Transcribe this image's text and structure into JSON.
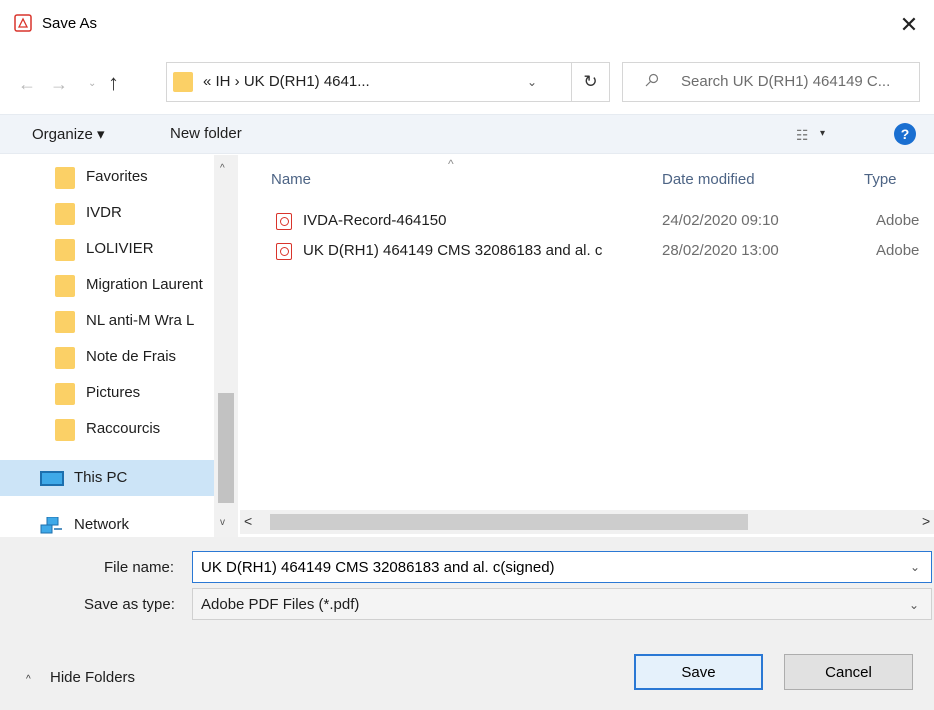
{
  "window": {
    "title": "Save As",
    "close_glyph": "✕",
    "title_icon": "pdf-icon"
  },
  "nav": {
    "back_glyph": "←",
    "forward_glyph": "→",
    "recent_glyph": "⌄",
    "up_glyph": "↑",
    "address_path": "«  IH  ›  UK D(RH1) 4641...",
    "address_chevron": "⌄",
    "refresh_glyph": "↻",
    "search_placeholder": "Search UK D(RH1) 464149 C..."
  },
  "toolbar": {
    "organize_label": "Organize ▾",
    "new_folder_label": "New folder",
    "view_glyph": "☷",
    "view_chevron": "▾",
    "help_glyph": "?"
  },
  "sidebar": {
    "folders": [
      {
        "label": "Favorites"
      },
      {
        "label": "IVDR"
      },
      {
        "label": "LOLIVIER"
      },
      {
        "label": "Migration Laurent"
      },
      {
        "label": "NL anti-M Wra L"
      },
      {
        "label": "Note de Frais"
      },
      {
        "label": "Pictures"
      },
      {
        "label": "Raccourcis"
      }
    ],
    "this_pc_label": "This PC",
    "network_label": "Network",
    "scroll_up_glyph": "^",
    "scroll_down_glyph": "v"
  },
  "filelist": {
    "sort_glyph": "^",
    "columns": {
      "name": "Name",
      "date": "Date modified",
      "type": "Type"
    },
    "rows": [
      {
        "name": "IVDA-Record-464150",
        "date": "24/02/2020 09:10",
        "type": "Adobe"
      },
      {
        "name": "UK D(RH1) 464149 CMS 32086183 and al. c",
        "date": "28/02/2020 13:00",
        "type": "Adobe"
      }
    ],
    "hscroll_left_glyph": "<",
    "hscroll_right_glyph": ">"
  },
  "form": {
    "file_name_label": "File name:",
    "file_name_value": "UK D(RH1) 464149 CMS 32086183 and al. c(signed)",
    "save_type_label": "Save as type:",
    "save_type_value": "Adobe PDF Files (*.pdf)",
    "dropdown_glyph": "⌄"
  },
  "footer": {
    "hide_folders_arrow": "^",
    "hide_folders_label": "Hide Folders",
    "save_label": "Save",
    "cancel_label": "Cancel"
  },
  "colors": {
    "folder": "#fbd066",
    "pdf_red": "#d9342b",
    "selection": "#cce4f7",
    "accent_blue": "#2a78d4",
    "help_blue": "#1a6fd1"
  }
}
